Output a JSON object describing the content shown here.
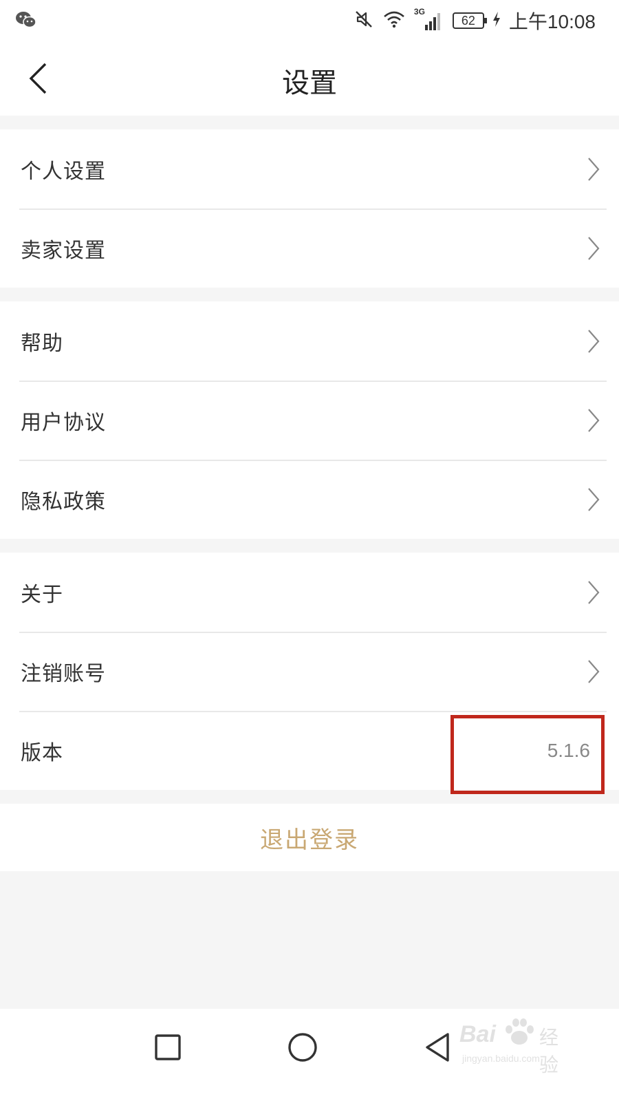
{
  "status_bar": {
    "time": "上午10:08",
    "battery_level": "62",
    "network_type": "3G",
    "icons": [
      "wechat-icon",
      "mute-icon",
      "wifi-icon",
      "signal-icon",
      "battery-icon",
      "charging-icon"
    ]
  },
  "header": {
    "title": "设置",
    "back_icon": "back-chevron-icon"
  },
  "groups": [
    {
      "items": [
        {
          "label": "个人设置"
        },
        {
          "label": "卖家设置"
        }
      ]
    },
    {
      "items": [
        {
          "label": "帮助"
        },
        {
          "label": "用户协议"
        },
        {
          "label": "隐私政策"
        }
      ]
    },
    {
      "items": [
        {
          "label": "关于"
        },
        {
          "label": "注销账号"
        },
        {
          "label": "版本",
          "value": "5.1.6"
        }
      ]
    }
  ],
  "logout": {
    "label": "退出登录"
  },
  "system_nav": [
    "recents-square-icon",
    "home-circle-icon",
    "back-triangle-icon"
  ],
  "watermark": {
    "brand": "Bai",
    "suffix": "经验",
    "url": "jingyan.baidu.com"
  },
  "colors": {
    "accent": "#c9a873",
    "highlight_box": "#c0281c",
    "background": "#f5f5f5",
    "divider": "#e8e8e8"
  }
}
